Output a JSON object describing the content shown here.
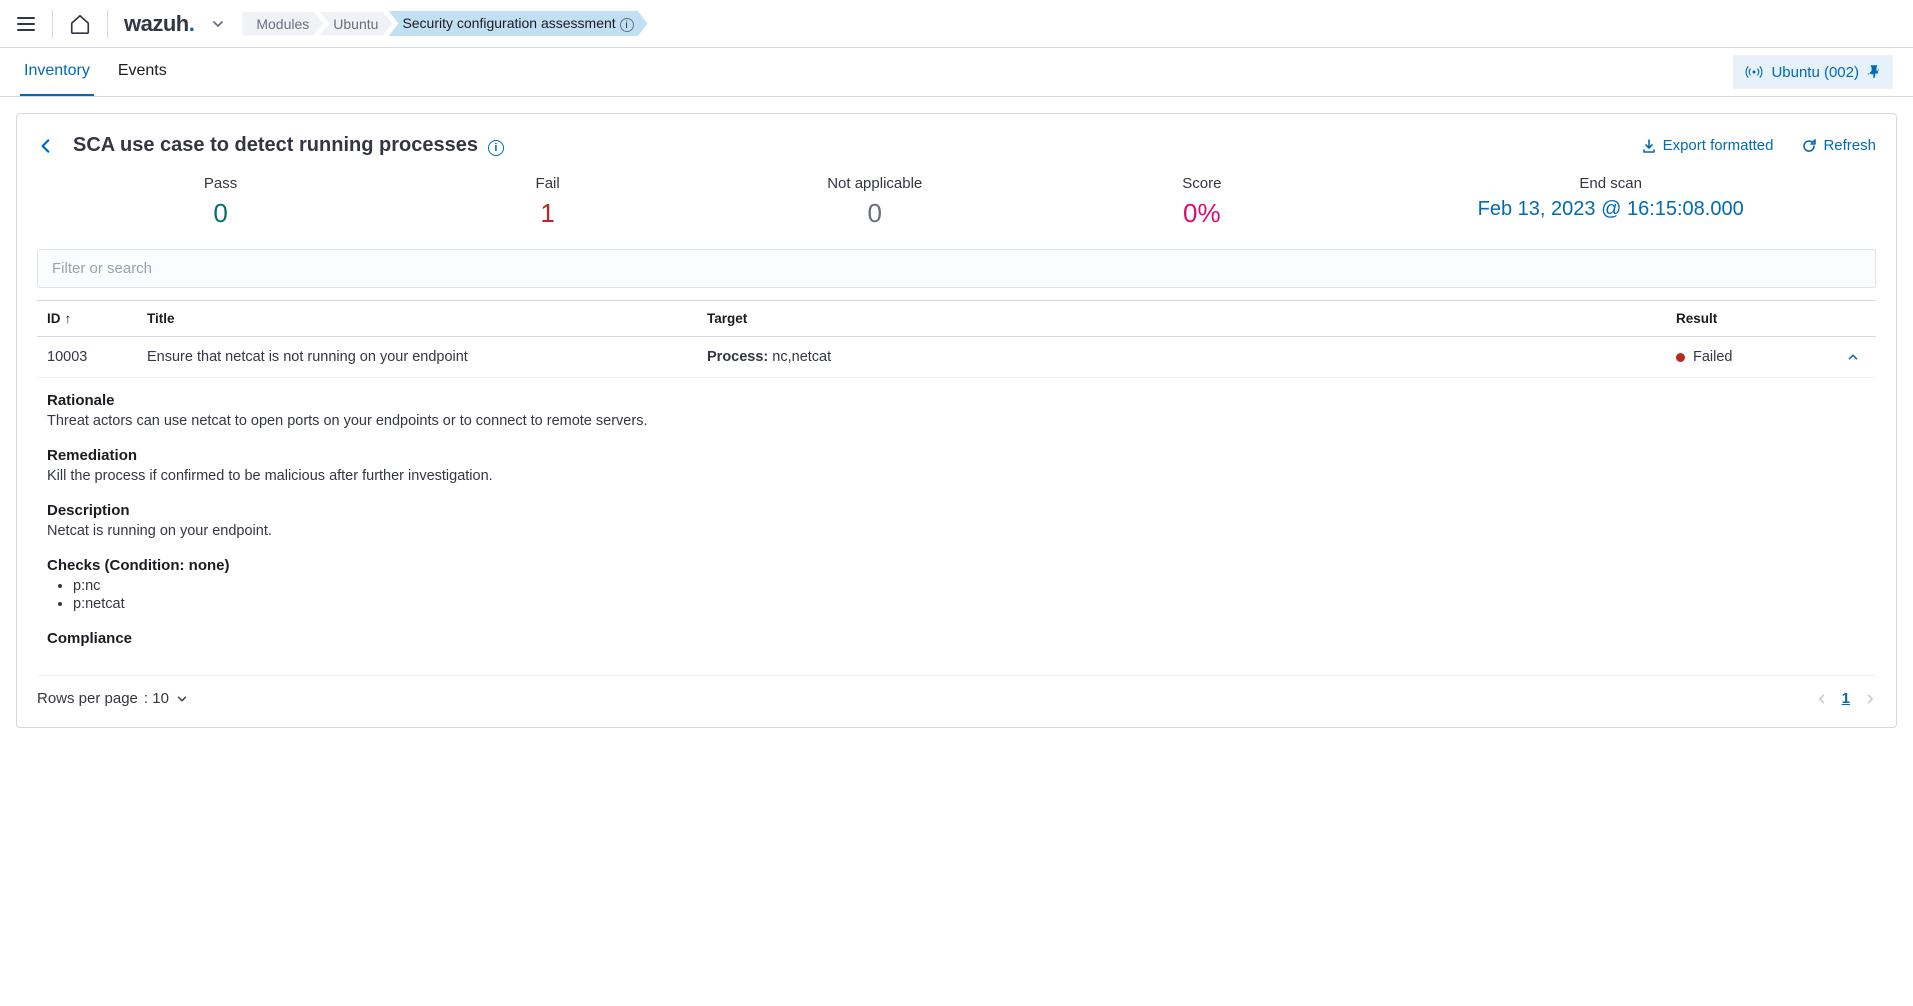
{
  "topbar": {
    "logo_name": "wazuh",
    "breadcrumbs": [
      "Modules",
      "Ubuntu",
      "Security configuration assessment"
    ]
  },
  "subnav": {
    "tabs": [
      "Inventory",
      "Events"
    ],
    "active_tab": 0,
    "agent_label": "Ubuntu (002)"
  },
  "panel": {
    "title": "SCA use case to detect running processes",
    "actions": {
      "export": "Export formatted",
      "refresh": "Refresh"
    },
    "stats": {
      "pass": {
        "label": "Pass",
        "value": "0"
      },
      "fail": {
        "label": "Fail",
        "value": "1"
      },
      "na": {
        "label": "Not applicable",
        "value": "0"
      },
      "score": {
        "label": "Score",
        "value": "0%"
      },
      "end_scan": {
        "label": "End scan",
        "value": "Feb 13, 2023 @ 16:15:08.000"
      }
    },
    "search_placeholder": "Filter or search",
    "columns": {
      "id": "ID",
      "title": "Title",
      "target": "Target",
      "result": "Result"
    },
    "row": {
      "id": "10003",
      "title": "Ensure that netcat is not running on your endpoint",
      "target_label": "Process:",
      "target_value": " nc,netcat",
      "result": "Failed"
    },
    "details": {
      "rationale": {
        "heading": "Rationale",
        "text": "Threat actors can use netcat to open ports on your endpoints or to connect to remote servers."
      },
      "remediation": {
        "heading": "Remediation",
        "text": "Kill the process if confirmed to be malicious after further investigation."
      },
      "description": {
        "heading": "Description",
        "text": "Netcat is running on your endpoint."
      },
      "checks": {
        "heading": "Checks (Condition: none)",
        "items": [
          "p:nc",
          "p:netcat"
        ]
      },
      "compliance": {
        "heading": "Compliance"
      }
    },
    "footer": {
      "rows_label": "Rows per page",
      "rows_value": ": 10",
      "current_page": "1"
    }
  }
}
